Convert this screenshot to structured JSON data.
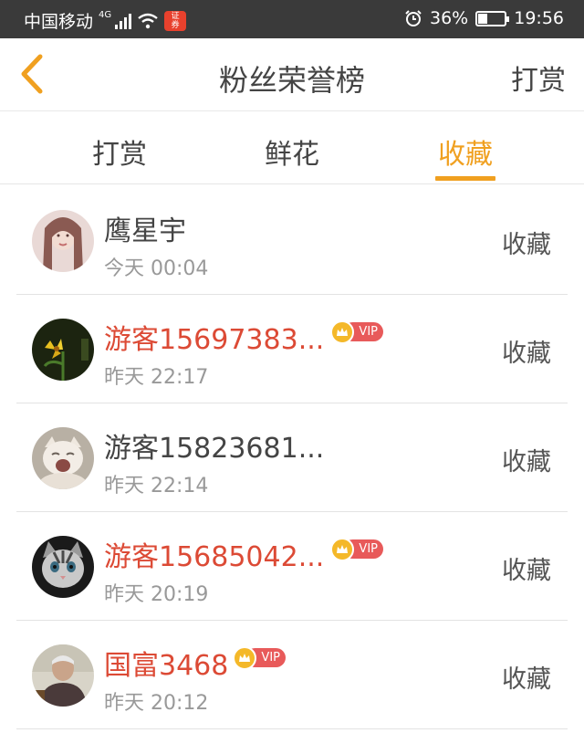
{
  "status_bar": {
    "carrier": "中国移动",
    "network": "4G",
    "battery_text": "36%",
    "battery_level": 0.36,
    "time": "19:56"
  },
  "header": {
    "title": "粉丝荣誉榜",
    "right_action": "打赏"
  },
  "tabs": [
    {
      "label": "打赏",
      "active": false
    },
    {
      "label": "鲜花",
      "active": false
    },
    {
      "label": "收藏",
      "active": true
    }
  ],
  "list": [
    {
      "name": "鹰星宇",
      "time": "今天 00:04",
      "action": "收藏",
      "vip": false,
      "avatar": "avatar-woman-icon"
    },
    {
      "name": "游客15697383...",
      "time": "昨天 22:17",
      "action": "收藏",
      "vip": true,
      "vip_label": "VIP",
      "avatar": "avatar-flower-icon"
    },
    {
      "name": "游客15823681...",
      "time": "昨天 22:14",
      "action": "收藏",
      "vip": false,
      "avatar": "avatar-cat-icon"
    },
    {
      "name": "游客15685042...",
      "time": "昨天 20:19",
      "action": "收藏",
      "vip": true,
      "vip_label": "VIP",
      "avatar": "avatar-kitten-icon"
    },
    {
      "name": "国富3468",
      "time": "昨天 20:12",
      "action": "收藏",
      "vip": true,
      "vip_label": "VIP",
      "avatar": "avatar-elder-icon"
    }
  ],
  "colors": {
    "accent": "#f0a020",
    "vip_name": "#dc4a35",
    "vip_badge": "#e85a5a",
    "crown": "#f4b829",
    "status_bar_bg": "#3a3a3a"
  }
}
